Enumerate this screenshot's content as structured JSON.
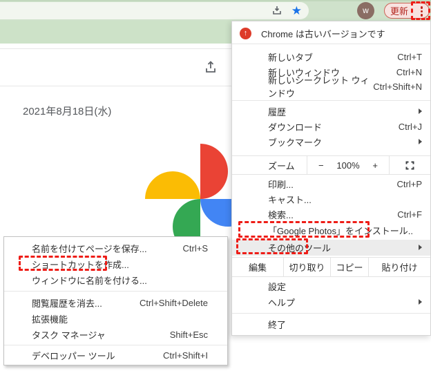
{
  "toolbar": {
    "update_button_label": "更新",
    "avatar_letter": "w"
  },
  "page": {
    "date_header": "2021年8月18日(水)"
  },
  "menu": {
    "update_banner": "Chrome は古いバージョンです",
    "group1": [
      {
        "label": "新しいタブ",
        "shortcut": "Ctrl+T"
      },
      {
        "label": "新しいウィンドウ",
        "shortcut": "Ctrl+N"
      },
      {
        "label": "新しいシークレット ウィンドウ",
        "shortcut": "Ctrl+Shift+N"
      }
    ],
    "group2": [
      {
        "label": "履歴"
      },
      {
        "label": "ダウンロード",
        "shortcut": "Ctrl+J"
      },
      {
        "label": "ブックマーク"
      }
    ],
    "zoom_row": {
      "label": "ズーム",
      "minus": "−",
      "value": "100%",
      "plus": "+"
    },
    "group3": [
      {
        "label": "印刷...",
        "shortcut": "Ctrl+P"
      },
      {
        "label": "キャスト..."
      },
      {
        "label": "検索...",
        "shortcut": "Ctrl+F"
      },
      {
        "label": "「Google Photos」をインストール.."
      },
      {
        "label": "その他のツール"
      }
    ],
    "edit_row": {
      "label": "編集",
      "cut": "切り取り",
      "copy": "コピー",
      "paste": "貼り付け"
    },
    "group4": [
      {
        "label": "設定"
      },
      {
        "label": "ヘルプ"
      }
    ],
    "group5": [
      {
        "label": "終了"
      }
    ]
  },
  "submenu": {
    "items": [
      {
        "label": "名前を付けてページを保存...",
        "shortcut": "Ctrl+S"
      },
      {
        "label": "ショートカットを作成..."
      },
      {
        "label": "ウィンドウに名前を付ける..."
      },
      {
        "label": "閲覧履歴を消去...",
        "shortcut": "Ctrl+Shift+Delete"
      },
      {
        "label": "拡張機能"
      },
      {
        "label": "タスク マネージャ",
        "shortcut": "Shift+Esc"
      },
      {
        "label": "デベロッパー ツール",
        "shortcut": "Ctrl+Shift+I"
      }
    ]
  },
  "theme": {
    "toolbar_green": "#cfe2cb",
    "band_green": "#cde2c8",
    "omnibox_bg": "#f2f6ef",
    "annotation_red": "#ee1d17",
    "update_text_red": "#b3261e",
    "update_pill_bg": "#f8e3e0",
    "update_pill_border": "#cd6459",
    "avatar_bg": "#8a6d64",
    "bookmark_star_blue": "#1a73e8",
    "menu_highlight_gray": "#ececec",
    "logo_red": "#ea4335",
    "logo_yellow": "#fbbc04",
    "logo_green": "#34a853",
    "logo_blue": "#4285f4"
  }
}
